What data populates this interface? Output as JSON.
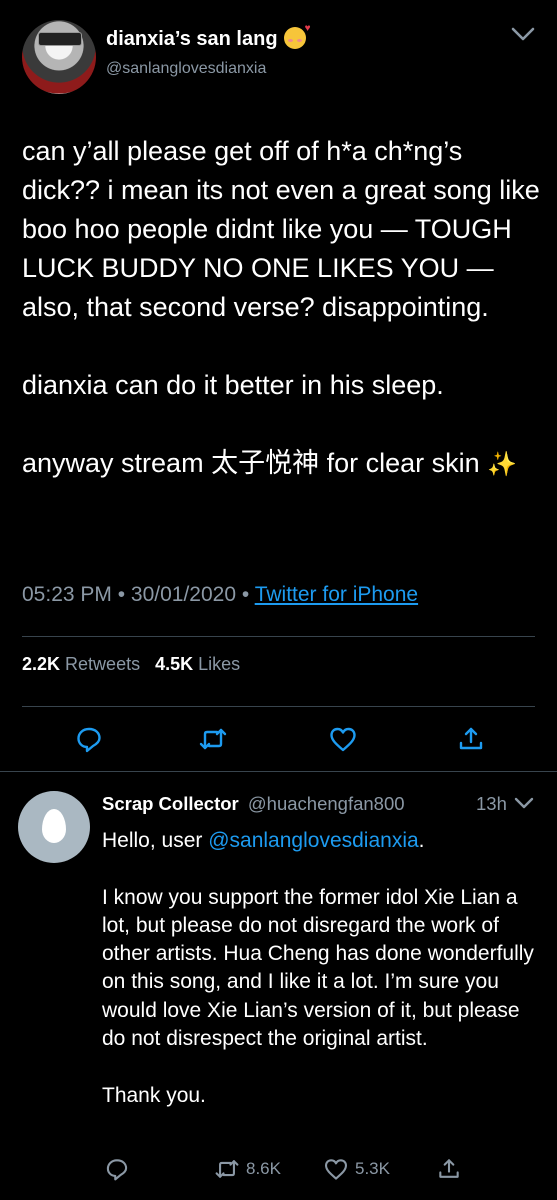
{
  "tweet": {
    "display_name": "dianxia’s san lang",
    "display_name_emoji": "smiling-face-with-hearts",
    "handle": "@sanlanglovesdianxia",
    "text_lines": [
      "can y’all please get off of h*a ch*ng’s dick?? i mean its not even a great song like boo hoo people didnt like you — TOUGH LUCK BUDDY NO ONE LIKES YOU — also, that second verse? disappointing.",
      "dianxia can do it better in his sleep.",
      "anyway stream 太子悦神 for clear skin"
    ],
    "sparkle": "✨",
    "time": "05:23 PM",
    "date": "30/01/2020",
    "source": "Twitter for iPhone",
    "retweets_count": "2.2K",
    "retweets_label": "Retweets",
    "likes_count": "4.5K",
    "likes_label": "Likes"
  },
  "reply": {
    "name": "Scrap Collector",
    "handle": "@huachengfan800",
    "time": "13h",
    "greeting_prefix": "Hello, user ",
    "mention": "@sanlanglovesdianxia",
    "greeting_suffix": ".",
    "paragraph": "I know you support the former idol Xie Lian a lot, but please do not disregard the work of other artists. Hua Cheng has done wonderfully on this song, and I like it a lot. I’m sure you would love Xie Lian’s version of it, but please do not disrespect the original artist.",
    "closing": "Thank you.",
    "retweets": "8.6K",
    "likes": "5.3K"
  },
  "colors": {
    "background": "#000000",
    "text": "#ffffff",
    "secondary": "#8b98a5",
    "link": "#1d9bf0",
    "divider": "#38444d"
  },
  "icons": [
    "chevron-down-icon",
    "reply-icon",
    "retweet-icon",
    "like-icon",
    "share-icon",
    "default-egg-avatar"
  ]
}
